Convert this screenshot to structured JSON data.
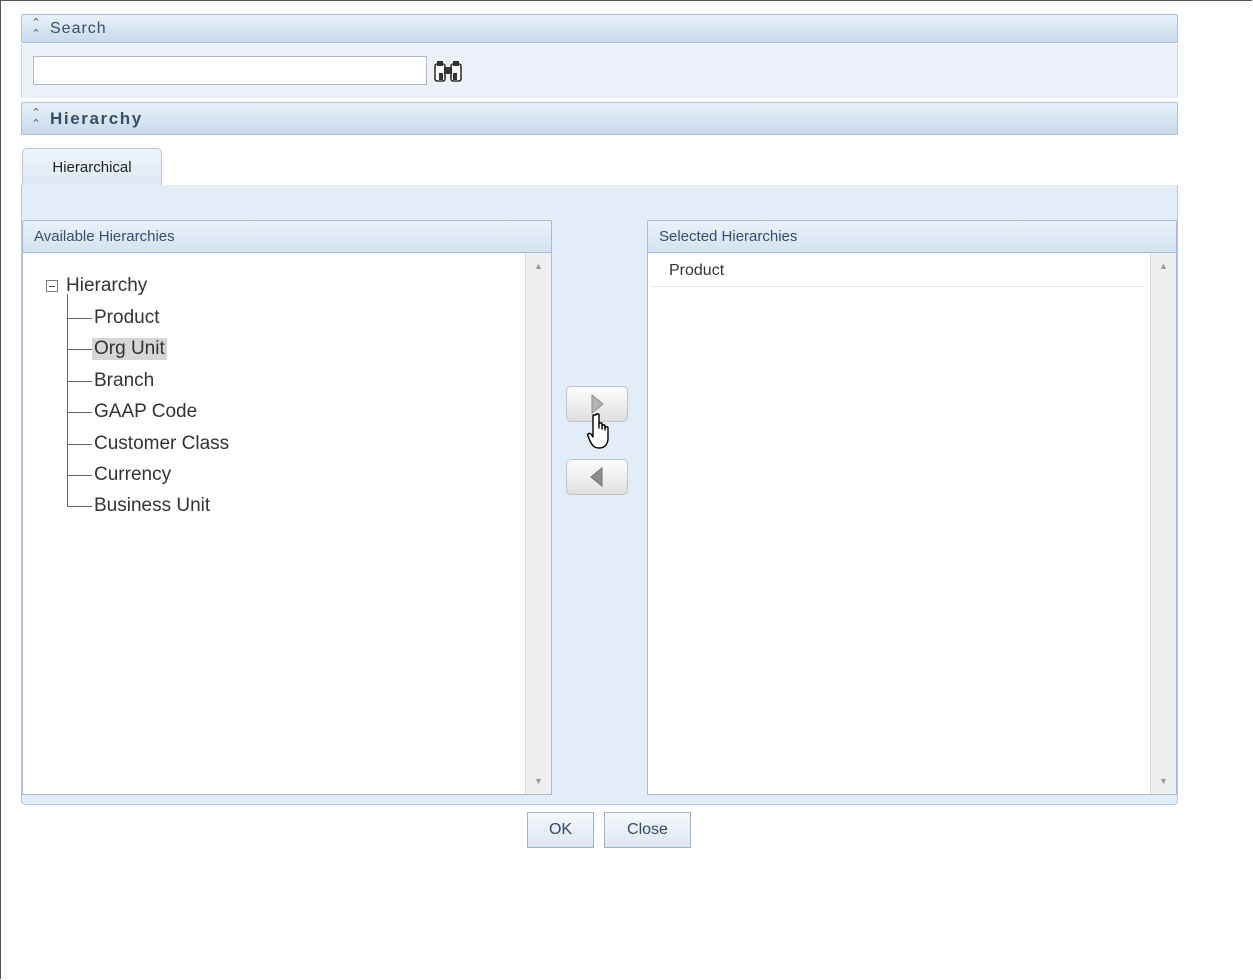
{
  "search_section": {
    "title": "Search",
    "input_value": "",
    "collapse_icon": "double-chevron-up-icon",
    "search_icon": "binoculars-icon"
  },
  "hierarchy_section": {
    "title": "Hierarchy",
    "collapse_icon": "double-chevron-up-icon"
  },
  "tabs": [
    {
      "label": "Hierarchical",
      "active": true
    }
  ],
  "available_panel": {
    "header": "Available Hierarchies",
    "tree": {
      "root": "Hierarchy",
      "items": [
        "Product",
        "Org Unit",
        "Branch",
        "GAAP Code",
        "Customer Class",
        "Currency",
        "Business Unit"
      ],
      "selected": "Org Unit"
    }
  },
  "selected_panel": {
    "header": "Selected Hierarchies",
    "items": [
      "Product"
    ]
  },
  "move_buttons": {
    "add_icon": "arrow-right-icon",
    "remove_icon": "arrow-left-icon"
  },
  "footer": {
    "ok_label": "OK",
    "close_label": "Close"
  },
  "colors": {
    "header_text": "#34506a",
    "panel_bg": "#e3edf7",
    "border": "#a8bccd"
  }
}
